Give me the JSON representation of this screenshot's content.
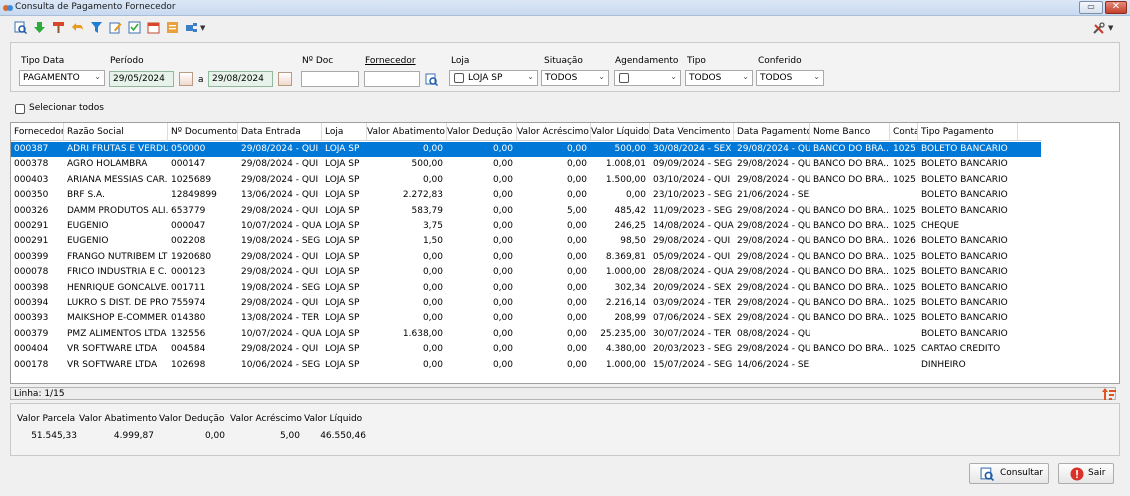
{
  "window": {
    "title": "Consulta de Pagamento Fornecedor"
  },
  "toolbar": {
    "icons": [
      "search-icon",
      "download-icon",
      "paint-icon",
      "undo-icon",
      "filter-icon",
      "edit-icon",
      "checklist-icon",
      "calendar-icon",
      "report-icon",
      "plugin-icon"
    ],
    "tools_icon": "tools-icon"
  },
  "filters": {
    "tipo_data": {
      "label": "Tipo Data",
      "value": "PAGAMENTO"
    },
    "periodo": {
      "label": "Período",
      "from": "29/05/2024",
      "sep": "a",
      "to": "29/08/2024"
    },
    "num_doc": {
      "label": "Nº Doc",
      "value": ""
    },
    "fornecedor": {
      "label": "Fornecedor",
      "value": ""
    },
    "loja": {
      "label": "Loja",
      "value": "LOJA SP"
    },
    "situacao": {
      "label": "Situação",
      "value": "TODOS"
    },
    "agendamento": {
      "label": "Agendamento",
      "value": ""
    },
    "tipo": {
      "label": "Tipo",
      "value": "TODOS"
    },
    "conferido": {
      "label": "Conferido",
      "value": "TODOS"
    }
  },
  "select_all": {
    "label": "Selecionar todos"
  },
  "grid": {
    "columns": [
      "Fornecedor",
      "Razão Social",
      "Nº Documento",
      "Data Entrada",
      "Loja",
      "Valor Abatimento",
      "Valor Dedução",
      "Valor Acréscimo",
      "Valor Líquido",
      "Data Vencimento",
      "Data Pagamento",
      "Nome Banco",
      "Conta",
      "Tipo Pagamento"
    ],
    "rows": [
      [
        "000387",
        "ADRI FRUTAS E VERDU...",
        "050000",
        "29/08/2024 - QUI",
        "LOJA SP",
        "0,00",
        "0,00",
        "0,00",
        "500,00",
        "30/08/2024 - SEX",
        "29/08/2024 - QUI",
        "BANCO DO BRA...",
        "1025",
        "BOLETO BANCARIO"
      ],
      [
        "000378",
        "AGRO HOLAMBRA",
        "000147",
        "29/08/2024 - QUI",
        "LOJA SP",
        "500,00",
        "0,00",
        "0,00",
        "1.008,01",
        "09/09/2024 - SEG",
        "29/08/2024 - QUI",
        "BANCO DO BRA...",
        "1025",
        "BOLETO BANCARIO"
      ],
      [
        "000403",
        "ARIANA MESSIAS CAR...",
        "1025689",
        "29/08/2024 - QUI",
        "LOJA SP",
        "0,00",
        "0,00",
        "0,00",
        "1.500,00",
        "03/10/2024 - QUI",
        "29/08/2024 - QUI",
        "BANCO DO BRA...",
        "1025",
        "BOLETO BANCARIO"
      ],
      [
        "000350",
        "BRF S.A.",
        "12849899",
        "13/06/2024 - QUI",
        "LOJA SP",
        "2.272,83",
        "0,00",
        "0,00",
        "0,00",
        "23/10/2023 - SEG",
        "21/06/2024 - SEX",
        "",
        "",
        "BOLETO BANCARIO"
      ],
      [
        "000326",
        "DAMM PRODUTOS ALI...",
        "653779",
        "29/08/2024 - QUI",
        "LOJA SP",
        "583,79",
        "0,00",
        "5,00",
        "485,42",
        "11/09/2023 - SEG",
        "29/08/2024 - QUI",
        "BANCO DO BRA...",
        "1025",
        "BOLETO BANCARIO"
      ],
      [
        "000291",
        "EUGENIO",
        "000047",
        "10/07/2024 - QUA",
        "LOJA SP",
        "3,75",
        "0,00",
        "0,00",
        "246,25",
        "14/08/2024 - QUA",
        "29/08/2024 - QUI",
        "BANCO DO BRA...",
        "1025",
        "CHEQUE"
      ],
      [
        "000291",
        "EUGENIO",
        "002208",
        "19/08/2024 - SEG",
        "LOJA SP",
        "1,50",
        "0,00",
        "0,00",
        "98,50",
        "29/08/2024 - QUI",
        "29/08/2024 - QUI",
        "BANCO DO BRA...",
        "1026",
        "BOLETO BANCARIO"
      ],
      [
        "000399",
        "FRANGO NUTRIBEM LTDA",
        "1920680",
        "29/08/2024 - QUI",
        "LOJA SP",
        "0,00",
        "0,00",
        "0,00",
        "8.369,81",
        "05/09/2024 - QUI",
        "29/08/2024 - QUI",
        "BANCO DO BRA...",
        "1025",
        "BOLETO BANCARIO"
      ],
      [
        "000078",
        "FRICO INDUSTRIA E C...",
        "000123",
        "29/08/2024 - QUI",
        "LOJA SP",
        "0,00",
        "0,00",
        "0,00",
        "1.000,00",
        "28/08/2024 - QUA",
        "29/08/2024 - QUI",
        "BANCO DO BRA...",
        "1025",
        "BOLETO BANCARIO"
      ],
      [
        "000398",
        "HENRIQUE GONCALVE...",
        "001711",
        "19/08/2024 - SEG",
        "LOJA SP",
        "0,00",
        "0,00",
        "0,00",
        "302,34",
        "20/09/2024 - SEX",
        "29/08/2024 - QUI",
        "BANCO DO BRA...",
        "1025",
        "BOLETO BANCARIO"
      ],
      [
        "000394",
        "LUKRO S DIST. DE PRO...",
        "755974",
        "29/08/2024 - QUI",
        "LOJA SP",
        "0,00",
        "0,00",
        "0,00",
        "2.216,14",
        "03/09/2024 - TER",
        "29/08/2024 - QUI",
        "BANCO DO BRA...",
        "1025",
        "BOLETO BANCARIO"
      ],
      [
        "000393",
        "MAIKSHOP E-COMMER...",
        "014380",
        "13/08/2024 - TER",
        "LOJA SP",
        "0,00",
        "0,00",
        "0,00",
        "208,99",
        "07/06/2024 - SEX",
        "29/08/2024 - QUI",
        "BANCO DO BRA...",
        "1025",
        "BOLETO BANCARIO"
      ],
      [
        "000379",
        "PMZ ALIMENTOS LTDA",
        "132556",
        "10/07/2024 - QUA",
        "LOJA SP",
        "1.638,00",
        "0,00",
        "0,00",
        "25.235,00",
        "30/07/2024 - TER",
        "08/08/2024 - QUI",
        "",
        "",
        "BOLETO BANCARIO"
      ],
      [
        "000404",
        "VR SOFTWARE LTDA",
        "004584",
        "29/08/2024 - QUI",
        "LOJA SP",
        "0,00",
        "0,00",
        "0,00",
        "4.380,00",
        "20/03/2023 - SEG",
        "29/08/2024 - QUI",
        "BANCO DO BRA...",
        "1025",
        "CARTAO CREDITO"
      ],
      [
        "000178",
        "VR SOFTWARE LTDA",
        "102698",
        "10/06/2024 - SEG",
        "LOJA SP",
        "0,00",
        "0,00",
        "0,00",
        "1.000,00",
        "15/07/2024 - SEG",
        "14/06/2024 - SEX",
        "",
        "",
        "DINHEIRO"
      ]
    ],
    "selected_row": 0
  },
  "status": {
    "line": "Linha: 1/15"
  },
  "totals": {
    "headers": [
      "Valor Parcela",
      "Valor Abatimento",
      "Valor Dedução",
      "Valor Acréscimo",
      "Valor Líquido"
    ],
    "values": [
      "51.545,33",
      "4.999,87",
      "0,00",
      "5,00",
      "46.550,46"
    ]
  },
  "buttons": {
    "consultar": "Consultar",
    "sair": "Sair"
  },
  "colors": {
    "selection": "#0078d7",
    "date_bg": "#e7f3ea"
  }
}
